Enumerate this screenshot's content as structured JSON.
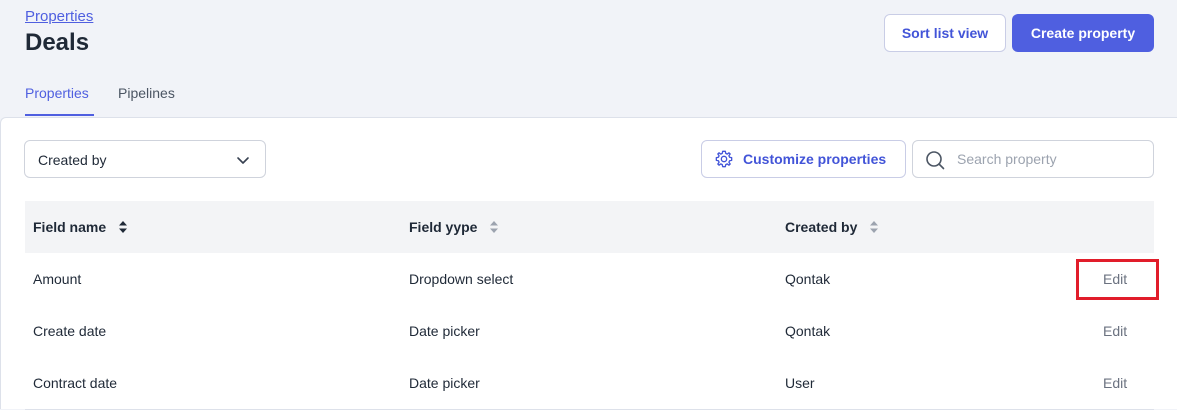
{
  "header": {
    "breadcrumb": "Properties",
    "title": "Deals",
    "sort_button": "Sort list view",
    "create_button": "Create property"
  },
  "tabs": [
    {
      "label": "Properties",
      "active": true
    },
    {
      "label": "Pipelines",
      "active": false
    }
  ],
  "toolbar": {
    "filter_value": "Created by",
    "customize_button": "Customize properties",
    "search_placeholder": "Search property"
  },
  "table": {
    "columns": [
      "Field name",
      "Field yype",
      "Created by"
    ],
    "rows": [
      {
        "field_name": "Amount",
        "field_type": "Dropdown select",
        "created_by": "Qontak",
        "action": "Edit"
      },
      {
        "field_name": "Create date",
        "field_type": "Date picker",
        "created_by": "Qontak",
        "action": "Edit"
      },
      {
        "field_name": "Contract date",
        "field_type": "Date picker",
        "created_by": "User",
        "action": "Edit"
      }
    ]
  },
  "colors": {
    "accent": "#4f5fe0",
    "highlight": "#e11d2a"
  },
  "icons": [
    "chevron-down-icon",
    "gear-icon",
    "search-icon",
    "sort-icon"
  ]
}
